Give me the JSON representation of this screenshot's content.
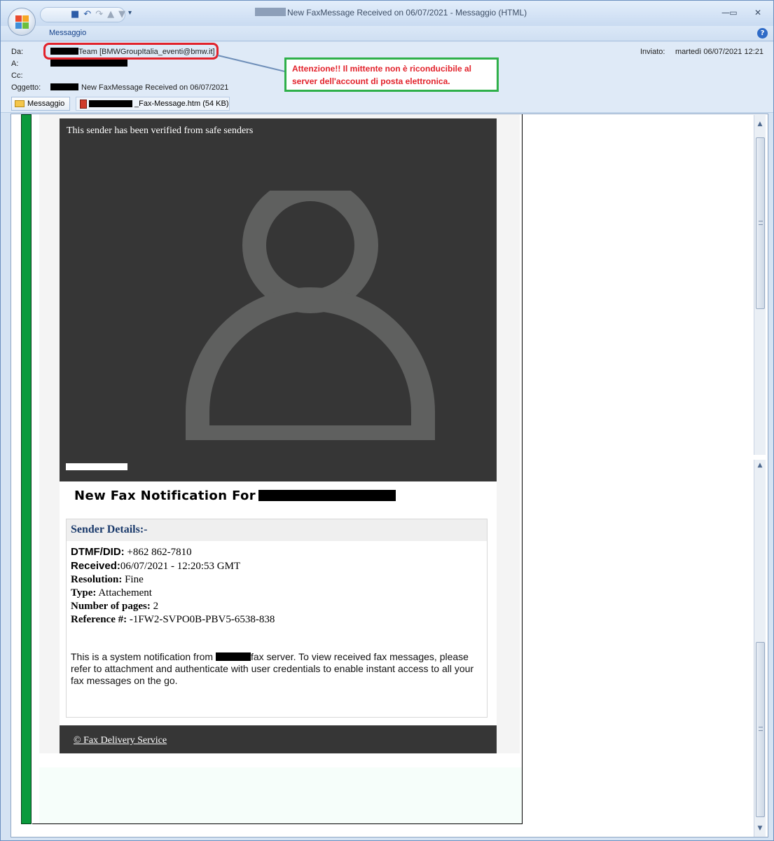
{
  "window": {
    "title": "New FaxMessage Received on 06/07/2021 - Messaggio (HTML)",
    "ribbon_tab": "Messaggio",
    "help": "?",
    "controls": {
      "minimize": "—",
      "maximize": "▭",
      "close": "✕"
    }
  },
  "header": {
    "from_label": "Da:",
    "from_value": "Team [BMWGroupItalia_eventi@bmw.it]",
    "to_label": "A:",
    "cc_label": "Cc:",
    "subject_label": "Oggetto:",
    "subject_value": "New FaxMessage Received on 06/07/2021",
    "sent_label": "Inviato:",
    "sent_value": "martedì 06/07/2021 12:21"
  },
  "warning": {
    "text": "Attenzione!! Il mittente non è riconducibile al server dell'account di posta elettronica.",
    "color": "#e2222b",
    "border_color": "#2fb04a"
  },
  "attachments": {
    "message_button": "Messaggio",
    "file": "_Fax-Message.htm (54 KB)"
  },
  "email": {
    "hero_text": "This sender has been verified from safe senders",
    "notification_title": "New Fax Notification For",
    "sender_details_heading": "Sender Details:-",
    "details": [
      {
        "label": "DTMF/DID:",
        "value": " +862 862-7810"
      },
      {
        "label": "Received:",
        "value": "06/07/2021 - 12:20:53 GMT"
      },
      {
        "label": "Resolution:",
        "value": " Fine"
      },
      {
        "label": "Type:",
        "value": " Attachement"
      },
      {
        "label": "Number of pages:",
        "value": " 2"
      },
      {
        "label": "Reference #:",
        "value": " -1FW2-SVPO0B-PBV5-6538-838"
      }
    ],
    "note_before": "This is a system notification from ",
    "note_after": "fax server. To view received fax messages, please refer to attachment and authenticate with user credentials to enable instant access to all your fax messages on the go.",
    "footer_link": "© Fax Delivery Service"
  },
  "icons": {
    "save": "save-icon",
    "undo": "undo-icon",
    "redo": "redo-icon",
    "prev": "up-arrow-icon",
    "next": "down-arrow-icon",
    "envelope": "envelope-icon",
    "file": "html-file-icon",
    "avatar": "user-avatar-icon"
  }
}
